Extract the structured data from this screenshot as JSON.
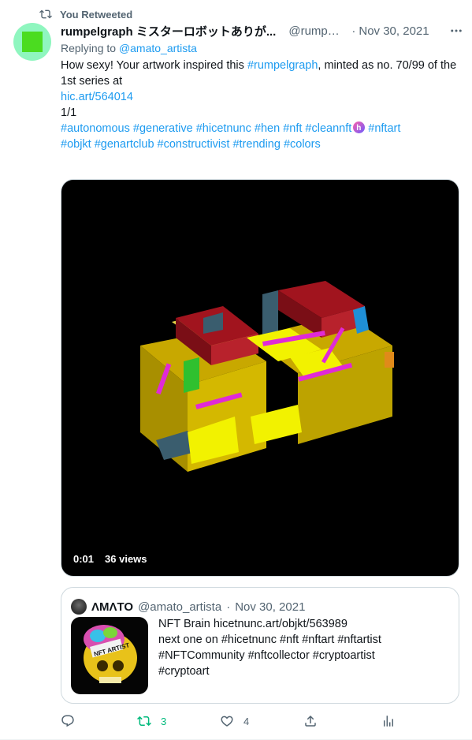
{
  "retweet_banner": {
    "label": "You Retweeted",
    "icon": "retweet-icon"
  },
  "author": {
    "name": "rumpelgraph ミスターロボットありが...",
    "handle": "@rumpel...",
    "separator": "·",
    "date": "Nov 30, 2021",
    "avatar_color": "#8ff6bf"
  },
  "replying": {
    "prefix": "Replying to ",
    "handle": "@amato_artista"
  },
  "tweet": {
    "line1_pre": "How sexy! Your artwork inspired this ",
    "line1_tag": "#rumpelgraph",
    "line1_post": ", minted as no. 70/99 of the 1st series at",
    "link": "hic.art/564014",
    "line3": "1/1",
    "tags_a": [
      "#autonomous",
      "#generative",
      "#hicetnunc",
      "#hen",
      "#nft",
      "#cleannft"
    ],
    "tags_b": [
      "#nftart"
    ],
    "tags_c": [
      "#objkt",
      "#genartclub",
      "#constructivist",
      "#trending",
      "#colors"
    ]
  },
  "media": {
    "time": "0:01",
    "views": "36 views"
  },
  "quote": {
    "name": "ΛMΛTO",
    "handle": "@amato_artista",
    "separator": "·",
    "date": "Nov 30, 2021",
    "text_lines": [
      "NFT Brain hicetnunc.art/objkt/563989",
      "next one on #hicetnunc #nft #nftart #nftartist",
      "#NFTCommunity #nftcollector #cryptoartist",
      "#cryptoart"
    ],
    "thumb_label": "NFT ARTIST"
  },
  "actions": {
    "reply_count": "",
    "retweet_count": "3",
    "like_count": "4"
  },
  "colors": {
    "link": "#1d9bf0",
    "retweeted": "#00ba7c",
    "muted": "#536471"
  }
}
